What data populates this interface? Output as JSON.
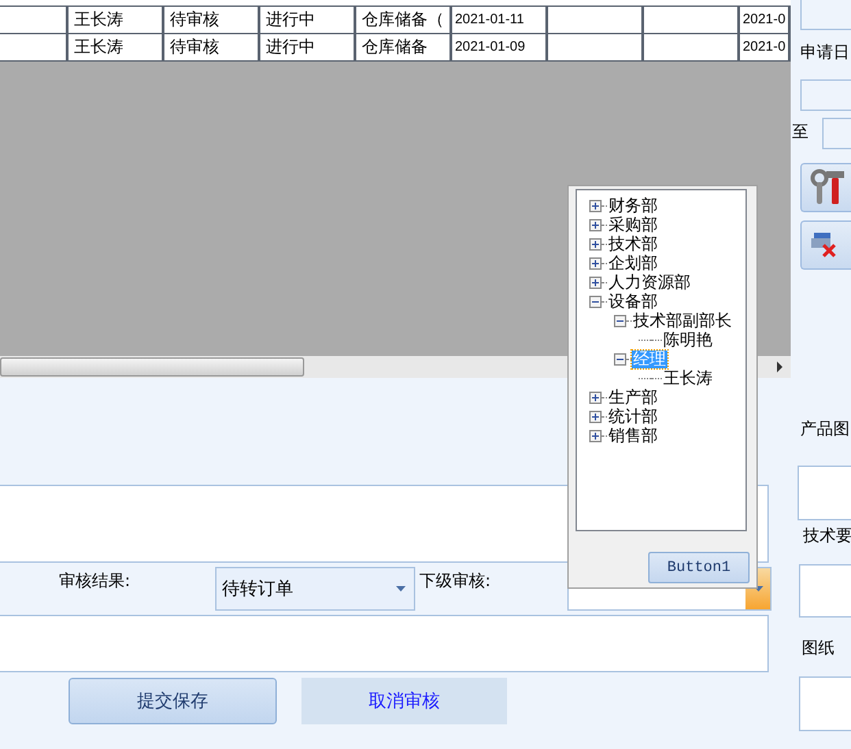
{
  "grid": {
    "rows": [
      {
        "cells": [
          null,
          "王长涛",
          "待审核",
          "进行中",
          "仓库储备（",
          "2021-01-11",
          null,
          null,
          "2021-0"
        ]
      },
      {
        "cells": [
          null,
          "王长涛",
          "待审核",
          "进行中",
          "仓库储备",
          "2021-01-09",
          null,
          null,
          "2021-0"
        ]
      }
    ]
  },
  "form": {
    "result_label": "审核结果:",
    "result_value": "待转订单",
    "next_label": "下级审核:",
    "buttons": [
      {
        "label": "提交保存",
        "kind": "raised"
      },
      {
        "label": "取消审核",
        "kind": "flat"
      }
    ]
  },
  "tree_popup": {
    "button": "Button1",
    "nodes": [
      {
        "label": "财务部",
        "expanded": false,
        "selected": false
      },
      {
        "label": "采购部",
        "expanded": false,
        "selected": false
      },
      {
        "label": "技术部",
        "expanded": false,
        "selected": false
      },
      {
        "label": "企划部",
        "expanded": false,
        "selected": false
      },
      {
        "label": "人力资源部",
        "expanded": false,
        "selected": false
      },
      {
        "label": "设备部",
        "expanded": true,
        "selected": false,
        "children": [
          {
            "label": "技术部副部长",
            "expanded": true,
            "selected": false,
            "children": [
              {
                "label": "陈明艳",
                "selected": false
              }
            ]
          },
          {
            "label": "经理",
            "expanded": true,
            "selected": true,
            "children": [
              {
                "label": "王长涛",
                "selected": false
              }
            ]
          }
        ]
      },
      {
        "label": "生产部",
        "expanded": false,
        "selected": false
      },
      {
        "label": "统计部",
        "expanded": false,
        "selected": false
      },
      {
        "label": "销售部",
        "expanded": false,
        "selected": false
      }
    ]
  },
  "side_panel": {
    "date_label": "申请日",
    "to_label": "至",
    "labels": [
      "产品图",
      "技术要",
      "图纸"
    ]
  }
}
